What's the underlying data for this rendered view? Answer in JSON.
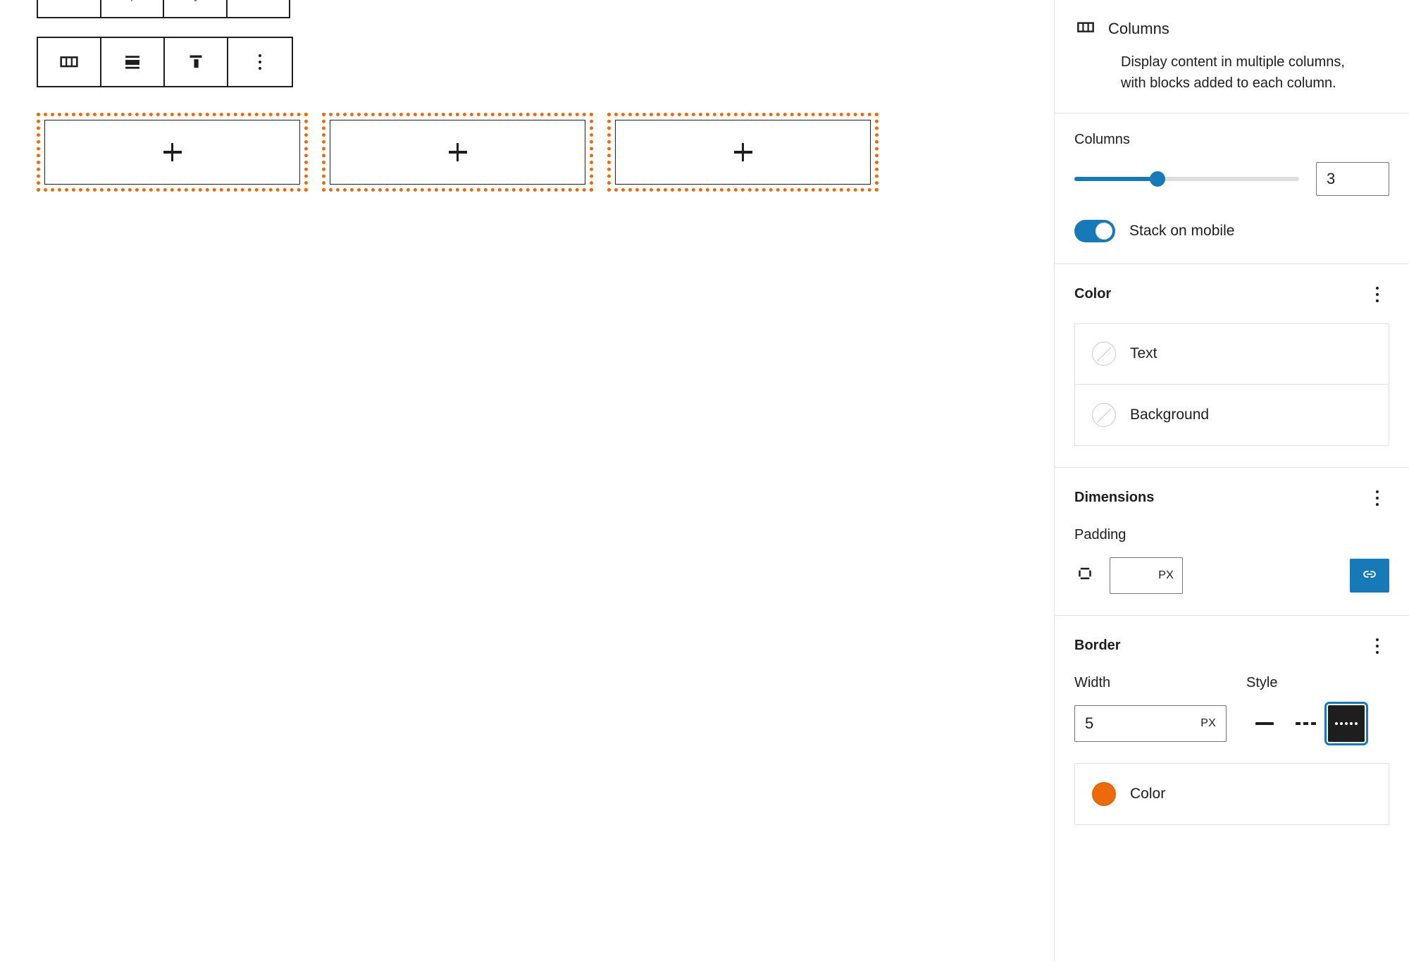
{
  "accent": {
    "blue": "#1879b9",
    "orange": "#ed6a0c",
    "dark": "#1e1e1e"
  },
  "canvas": {
    "toolbar": {
      "buttons": [
        {
          "name": "columns-block-type",
          "icon": "columns-icon",
          "label": "Columns"
        },
        {
          "name": "change-alignment",
          "icon": "align-center-icon",
          "label": "Align"
        },
        {
          "name": "vertical-align",
          "icon": "vertical-align-top-icon",
          "label": "Change vertical alignment"
        },
        {
          "name": "more-options",
          "icon": "more-vertical-icon",
          "label": "Options"
        }
      ]
    },
    "columns": [
      {
        "appender_label": "+"
      },
      {
        "appender_label": "+"
      },
      {
        "appender_label": "+"
      }
    ],
    "border_style": "dotted",
    "border_color": "#ed6a0c",
    "border_width_px": 5
  },
  "sidebar": {
    "block_card": {
      "icon": "columns-icon",
      "title": "Columns",
      "description": "Display content in multiple columns, with blocks added to each column."
    },
    "columns_section": {
      "label": "Columns",
      "slider": {
        "value": 3,
        "min": 1,
        "max": 6,
        "fill_percent": 37
      },
      "input_value": "3",
      "toggle": {
        "label": "Stack on mobile",
        "checked": true
      }
    },
    "color_section": {
      "title": "Color",
      "menu_icon": "more-vertical-icon",
      "items": [
        {
          "label": "Text",
          "value": null,
          "swatch": "empty"
        },
        {
          "label": "Background",
          "value": null,
          "swatch": "empty"
        }
      ]
    },
    "dimensions_section": {
      "title": "Dimensions",
      "menu_icon": "more-vertical-icon",
      "padding": {
        "label": "Padding",
        "sides_icon": "padding-sides-icon",
        "value": "",
        "unit": "PX",
        "link_icon": "link-icon",
        "link_active": true
      }
    },
    "border_section": {
      "title": "Border",
      "menu_icon": "more-vertical-icon",
      "width": {
        "label": "Width",
        "value": "5",
        "unit": "PX"
      },
      "style": {
        "label": "Style",
        "options": [
          {
            "name": "solid",
            "selected": false
          },
          {
            "name": "dashed",
            "selected": false
          },
          {
            "name": "dotted",
            "selected": true
          }
        ]
      },
      "color": {
        "label": "Color",
        "value": "#ed6a0c",
        "swatch": "filled"
      }
    }
  }
}
